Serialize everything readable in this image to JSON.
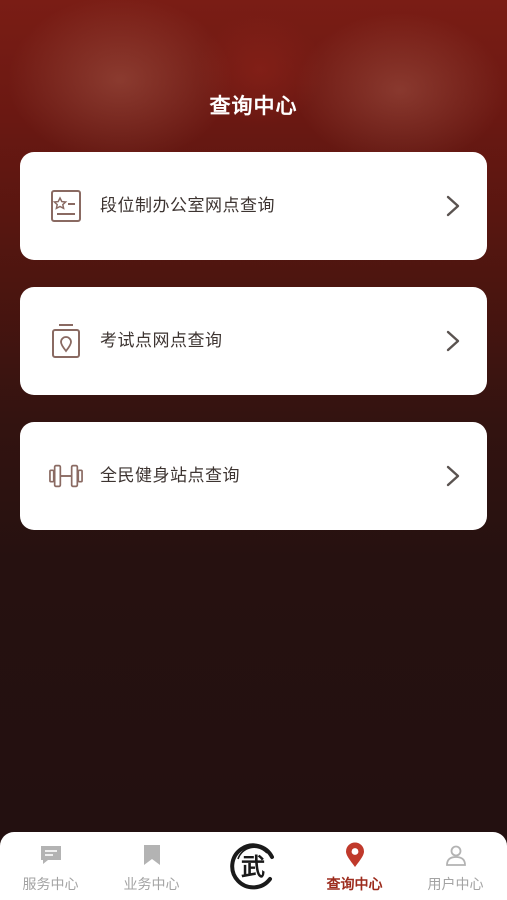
{
  "header": {
    "title": "查询中心"
  },
  "cards": [
    {
      "label": "段位制办公室网点查询",
      "icon": "id-card-icon"
    },
    {
      "label": "考试点网点查询",
      "icon": "location-document-icon"
    },
    {
      "label": "全民健身站点查询",
      "icon": "dumbbell-icon"
    }
  ],
  "tabbar": {
    "tabs": [
      {
        "label": "服务中心",
        "icon": "chat-bubble-icon",
        "active": false
      },
      {
        "label": "业务中心",
        "icon": "bookmark-icon",
        "active": false
      },
      {
        "label": "查询中心",
        "icon": "map-pin-icon",
        "active": true
      },
      {
        "label": "用户中心",
        "icon": "user-icon",
        "active": false
      }
    ],
    "center_logo_text": "武"
  },
  "colors": {
    "accent": "#9c2b1c",
    "icon_stroke": "#8a6a62",
    "inactive": "#a3a3a3",
    "background_top": "#7a1d15",
    "background_bottom": "#221010"
  }
}
